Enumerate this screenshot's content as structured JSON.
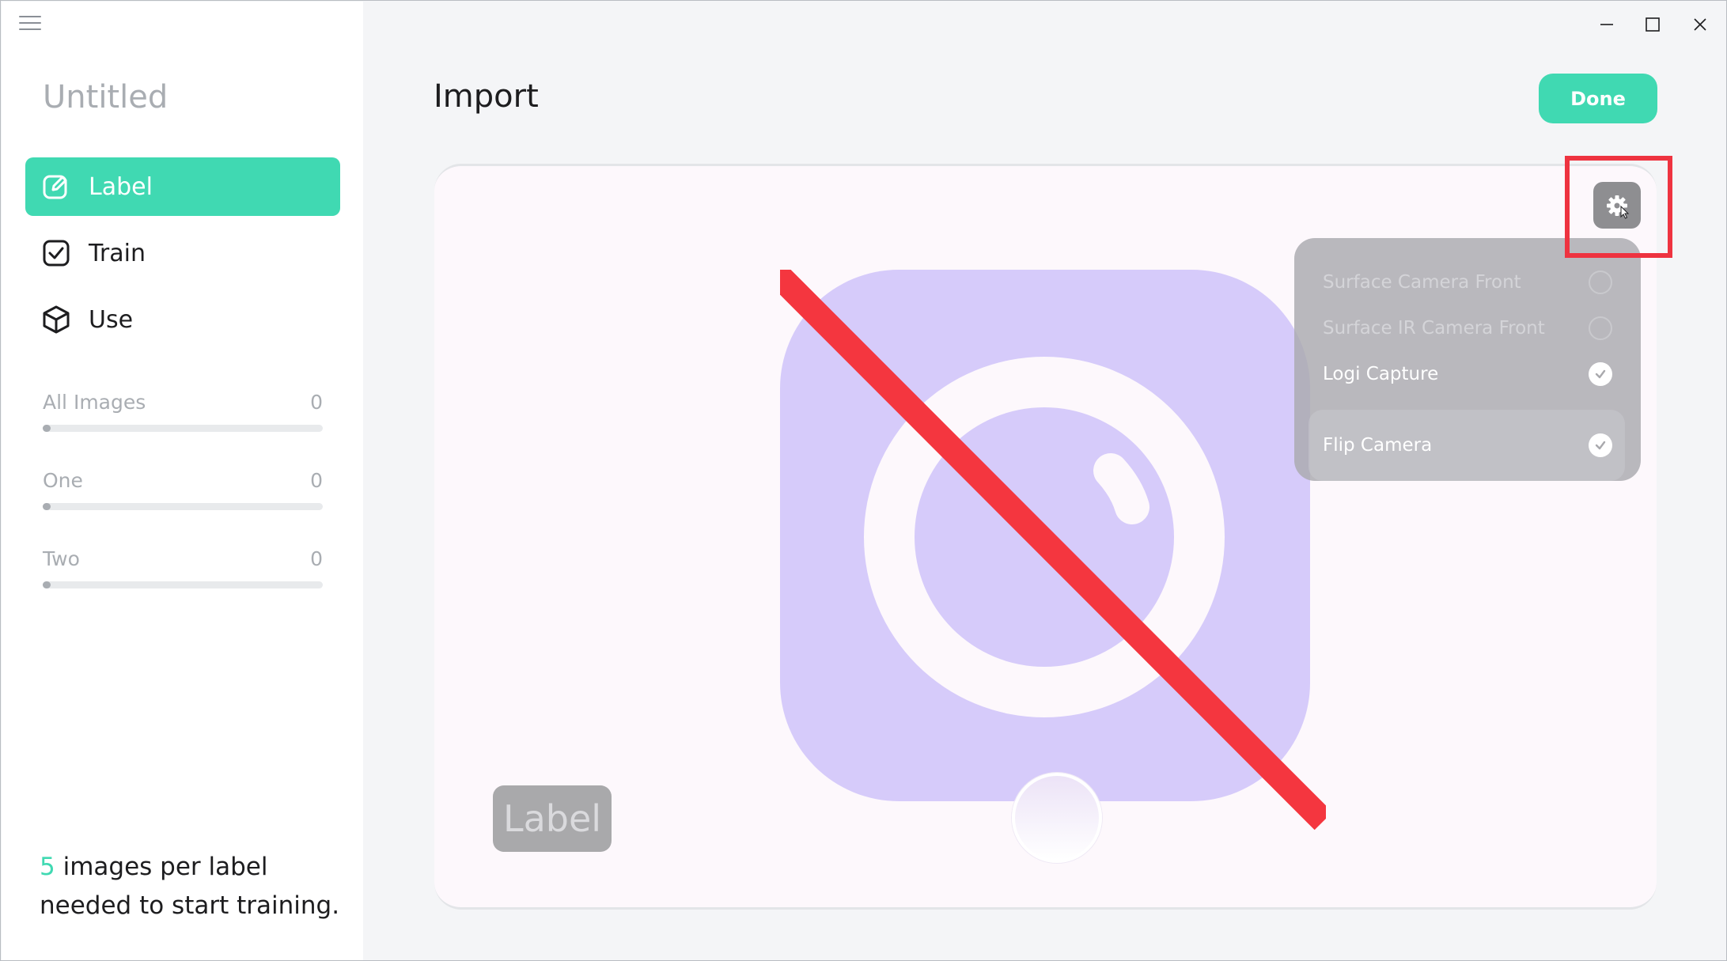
{
  "window": {
    "controls": {
      "minimize": "—",
      "maximize": "☐",
      "close": "✕"
    }
  },
  "sidebar": {
    "project_title": "Untitled",
    "nav": [
      {
        "label": "Label",
        "icon": "edit-icon",
        "active": true
      },
      {
        "label": "Train",
        "icon": "checkbox-icon",
        "active": false
      },
      {
        "label": "Use",
        "icon": "cube-icon",
        "active": false
      }
    ],
    "labels": [
      {
        "name": "All Images",
        "count": "0"
      },
      {
        "name": "One",
        "count": "0"
      },
      {
        "name": "Two",
        "count": "0"
      }
    ],
    "hint": {
      "number": "5",
      "text": " images per label needed to start training."
    }
  },
  "main": {
    "title": "Import",
    "done_label": "Done",
    "label_chip": "Label",
    "camera_menu": [
      {
        "label": "Surface Camera Front",
        "selected": false
      },
      {
        "label": "Surface IR Camera Front",
        "selected": false
      },
      {
        "label": "Logi Capture",
        "selected": true
      },
      {
        "label": "Flip Camera",
        "selected": true
      }
    ]
  },
  "colors": {
    "accent": "#40d9b2",
    "camera_tile": "#d6cbfa",
    "strike": "#f4363f",
    "highlight": "#ee3340"
  }
}
